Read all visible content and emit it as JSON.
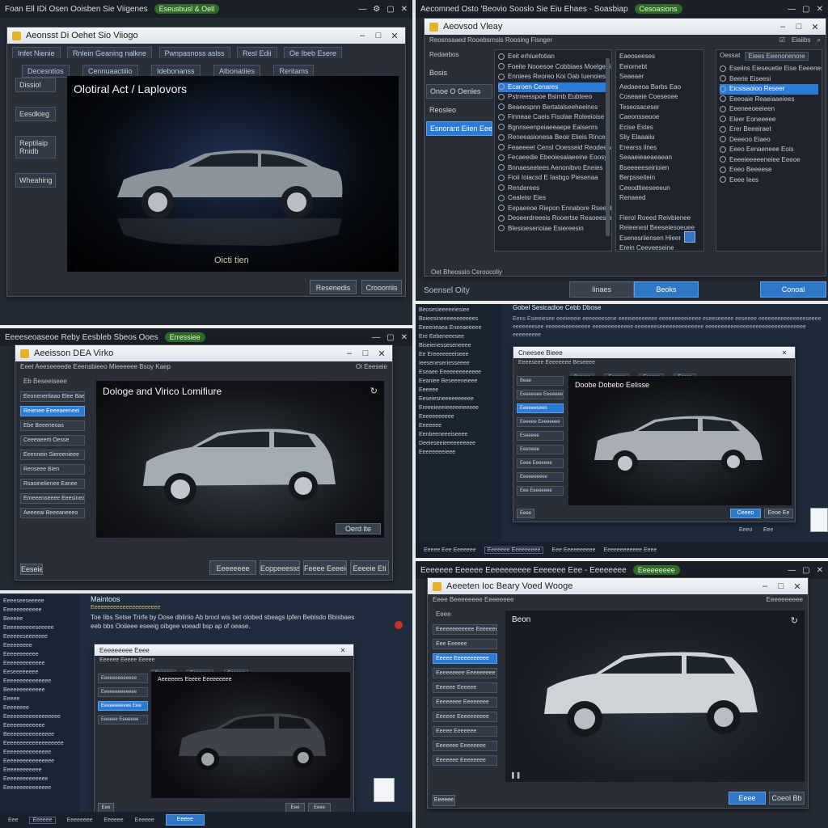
{
  "p1": {
    "topbar": "Foan Ell IDi Osen Ooisben Sie Viigenes",
    "badge": "Eseusbusl & Oell",
    "win_title": "Aeonsst Di Oehet Sio Viiogo",
    "toolbar": [
      "Infet Nienie",
      "Rnlein Geaning nalkne",
      "Pwnpasnoss aslss",
      "Resl Edii",
      "Oe Ibeb Esere"
    ],
    "tabs": [
      "Decesntios",
      "Cennuaactiiio",
      "Idebonanss",
      "Albonatiies",
      "Reritams"
    ],
    "side": [
      "Dissiol",
      "Eesdkieg",
      "Reptilaip Rnidb",
      "Wheahing"
    ],
    "viewer_title": "Olotiral Act / Laplovors",
    "caption": "Oicti tien",
    "btn_a": "Resenedis",
    "btn_b": "Crooorriis"
  },
  "p2": {
    "topbar": "Aecomned Osto 'Beovio Sooslo Sie Eiu Ehaes - Soasbiap",
    "badge": "Cesoasions",
    "win_title": "Aeovsod Vleay",
    "sub_title": "Reosnsaaed Rooebsrnsls Roosing Fisnger",
    "chk": "Eiaiibs",
    "left_head": "Redaebos",
    "left": [
      "Bosis",
      "Onoe O Oenles",
      "Reosleo",
      "Esnorant Eiien Eeerie"
    ],
    "list1": [
      "Eeit erhiuefotian",
      "Foeite Nooesoe Cobbiaes Moelgertiaees",
      "Enniees Reoreo Koi Oab Iuenoies",
      "Ecaroen Cenares",
      "Pstrreesspoe Bsirnb Eubteeo",
      "Beaeespnn Bertatalseeheeines",
      "Finneae Caeis Fisolae Roleeioise",
      "Bgnnseenpeiaeeaepe Ealsenrs",
      "Reneeasionesa Beoir Elieis Rinces",
      "Feaeeeet Censl Ooesseid Reodeeaosisoe",
      "Fecaeedie Ebeoiesalaeeine Eoosy",
      "Bnnaeseetees Aenonibvo Eneies",
      "Fioii Ioiacsd E Iasbgo Piesenaa",
      "Renderees",
      "Cealeisr Eies",
      "Eepaeeoe Riepon Ennabore Rseenbe",
      "Deoeerdreeeis Rooertse Reaoeesresinn",
      "Blesioeserioiae Esiereesin"
    ],
    "list1_sel": 3,
    "list2": [
      "Eaeoseeses",
      "Eeiornebt",
      "Seaeaer",
      "Aedaeeoa Barbs Eao",
      "Coseaeie Coeseoee",
      "Teseosaceser",
      "Caeonsseooe",
      "Ecise Estes",
      "Sliy Elaaaiiu",
      "Erearss ilnes",
      "Seaaeieaeaeaean",
      "Bseeeeeseirioien",
      "Berpsseitein",
      "Ceeodtieeseeeun",
      "Renaeed"
    ],
    "list2_lower": [
      "Fierol Roeed Reivbienee",
      "Reieenesl Beeseiesoeuee",
      "Esenesriiensen Hieer",
      "Erein Ceeveeseine"
    ],
    "list3_head": "Oessat",
    "list3_drop": "Eiees Eeenonenore",
    "list3": [
      "Eseiins Eieseuetie Eise Eeeenes",
      "Beerie Eiseesi",
      "Eicsisaoioo Reseer",
      "Eeeoaie Reaeiaaeiees",
      "Eeeneeoeeieen",
      "Eleer Eoneeeee",
      "Erer Beeeiraet",
      "Deeeoo Eiaeo",
      "Eeeo Eenaeneee Eois",
      "Eeeeieeeeeneiee Eeeoe",
      "Eeeo Beeeese",
      "Eeee Iees"
    ],
    "list3_sel": 2,
    "footer_left": "Oet Bheossio Ceroocoliy",
    "status": "Soensel Oity",
    "btn_tools": "Iinaes",
    "btn_back": "Beoks",
    "btn_cancel": "Conoal"
  },
  "p3": {
    "topbar": "Eeeeseoaseoe Reby Eesbleb Sbeos Ooes",
    "badge": "Erressiee",
    "win_title": "Aeeisson DEA Virko",
    "sub_title": "Eeet Aeeseeeede Eeensbieeo Mieeeeee Bsoy Kaep",
    "sub_right": "Oi Eeeseie",
    "side_head": "Eb Beseeiseee",
    "side": [
      "Eeonenertiaao Elee Baeeenee",
      "Reienee Eeeeaeeneei",
      "Ebe Beeeneoas",
      "Ceeeaeerti Oesse",
      "Eeennein Siereenieee",
      "Renseee Bien",
      "Rsaoinelienee Eanee",
      "Emeeenseeee Eeesineaeee",
      "Aeeeeai Beeeaneeeo"
    ],
    "side_sel": 1,
    "viewer_title": "Dologe and Virico Lomifiure",
    "small_btn": "Oerd ite",
    "footer_left": "Eeseie",
    "btns": [
      "Eeeeeeee",
      "Eoppeeesss",
      "Feeee Eeeeiee",
      "Eeeeie Eti"
    ]
  },
  "p4": {
    "left": [
      "Beosesieeeeeiesiee",
      "Boieesineeeeeeeeeees",
      "Eeeeneaea Eneeaeeeee",
      "Ere Eebeneeesee",
      "Biseienesseseneeee",
      "Ee Ereeeeeeeiseee",
      "Ieeseneseriesseeee",
      "Eseaee Eeeeeeeeeeeee",
      "Eeaniee Beseeeneieee",
      "Eeeeee",
      "",
      "Eeseiesneeeeeeeeee",
      "Ereeeieeeieeeeeieeeee",
      "Eeeeeeeeeee",
      "Eeeeeee",
      "Eenbeeneeeiseeee",
      "Deeieseeieeeeeeeeee",
      "Eeeeeeeeieee"
    ],
    "head": "Gobel Sesicadioe Cebb Dbose",
    "para": "Eens Esieeiesee eeeieeeie eeeeeeesene eeeeieeeeeeee eeeeeeeeeieeee eseeseeeee eeseeee eeeeeeeeeeeeeeeseeee eeeeeeesee eeeeeeieeeeeeee eeeeeeeeeeeee eeeeeeeseeeeeeeeeeeeee eeeeeeeeeeeeeeeeeeeeeeeeeeeeeeee eeeeeeeee",
    "win_title": "Cneesee Bieee",
    "sub": "Eeeeseee Eeeeeeee Beseeee",
    "tabs": [
      "Beesse",
      "Eeesee",
      "Eeeeee",
      "Eeeee"
    ],
    "side": [
      "Beae",
      "Eeeeeeee Eeeeeeeee",
      "Eeeeeeseen",
      "Eeeeee Eeeeeeee",
      "Eseeeee",
      "Eeeneee",
      "Eeee Eeeeeee",
      "Eeeeeeeeee",
      "Eee Eeeeeeee"
    ],
    "side_sel": 2,
    "viewer_title": "Doobe Dobebo Eelisse",
    "btn_a": "Ceeeo",
    "btn_b": "Eeoe Ee",
    "footer": [
      "Eeeee Eee Eeeeeee",
      "Eeeeeee Eeeeeeeee",
      "Eee Eeeeeeeeee",
      "Eeeeeeeeeeee Eeee"
    ],
    "tags": [
      "Eeeo",
      "Eee"
    ]
  },
  "p5": {
    "left": [
      "Eeeeseeseeeee",
      "Eeeeeeeeeeee",
      "Beeeee",
      "Eeeeeeeeeeseeeee",
      "Eeeeeeseeeeeee",
      "Eeeeeeeee",
      "Eeeeeeeeeee",
      "Eeeeeeeeeeeee",
      "Eeseeeeeeee",
      "Eeeeeeeeeeeeeee",
      "Beeeeeeeeeeee",
      "Eeeee",
      "Eeeeeeee",
      "Eeeeeeeeeeeeeeeeee",
      "Eeeeeeeeeeeee",
      "Beeeeeeeeeeeeeee",
      "Eeeeeeeeeeeeeeeeeee",
      "Eeeeeeeeeeeeeee",
      "Eeeeeeeeeeeeeeee",
      "Eeeeeeeeeeee",
      "Eeeeeeeeeeeeee",
      "Eeeeeeeeeeeeeee"
    ],
    "head": "Maintoos",
    "sub": "Eeeeeeeeeeeeeeeeeeeeee",
    "para": "Toe Iibs Setse Trirfe by Dose dbliriio Ab brool wis bet olobed sbeags lpfen Beblsdo Bbisbaes eeb bbs Ooiieee eseeig oibgee voeadl bsp ap of oease.",
    "win_title": "Eeeeeeeee Eeee",
    "sub2": "Eeeeee Eeeee Eeeee",
    "tabs": [
      "Eeeeee",
      "Eeeeeee",
      "Eeeeee"
    ],
    "side": [
      "Eeeeeeeeeeeee",
      "Eeeeeeeeeeeee",
      "Eeeeeeeeeee Eee",
      "Eeeeee Eeeeeee"
    ],
    "side_sel": 2,
    "viewer_title": "Aeeeeees Eeeee Eeeeeeeee",
    "footer": [
      "Eee",
      "Eeeeee",
      "Eeeeeeee",
      "Eeeeee",
      "Eeeeee"
    ],
    "btn": "Eeeee"
  },
  "p6": {
    "topbar": "Eeeeeee Eeeeee Eeeeeeeeee Eeeeeee Eee - Eeeeeeee",
    "badge": "Eeeeeeeee",
    "win_title": "Aeeeten Ioc Beary Voed Wooge",
    "sub_title": "Eeee Beeeeeeee Eeeeeeee",
    "sub_right": "Eeeeeeeeee",
    "side_head": "Eeee",
    "side": [
      "Eeeeeeeeeeee Eeeeeeeee",
      "Eee Eeeeee",
      "Eeeee Eeeeeeeeeee",
      "Eeeeeeeee Eeeeeeeee",
      "Eeeeee Eeeeee",
      "Eeeeeeee Eeeeeeee",
      "Eeeeee Eeeeeeeeee",
      "Eeeee Eeeeeee",
      "Eeeeeee Eeeeeeee",
      "Eeeeeee Eeeeeeee"
    ],
    "side_sel": 2,
    "viewer_title": "Beon",
    "footer_left": "Eeeeee",
    "btn_a": "Eeee",
    "btn_b": "Coeol Bb"
  },
  "colors": {
    "accent": "#2b7bd6",
    "panel": "#242a33",
    "titlebar": "#e4e8ee"
  }
}
